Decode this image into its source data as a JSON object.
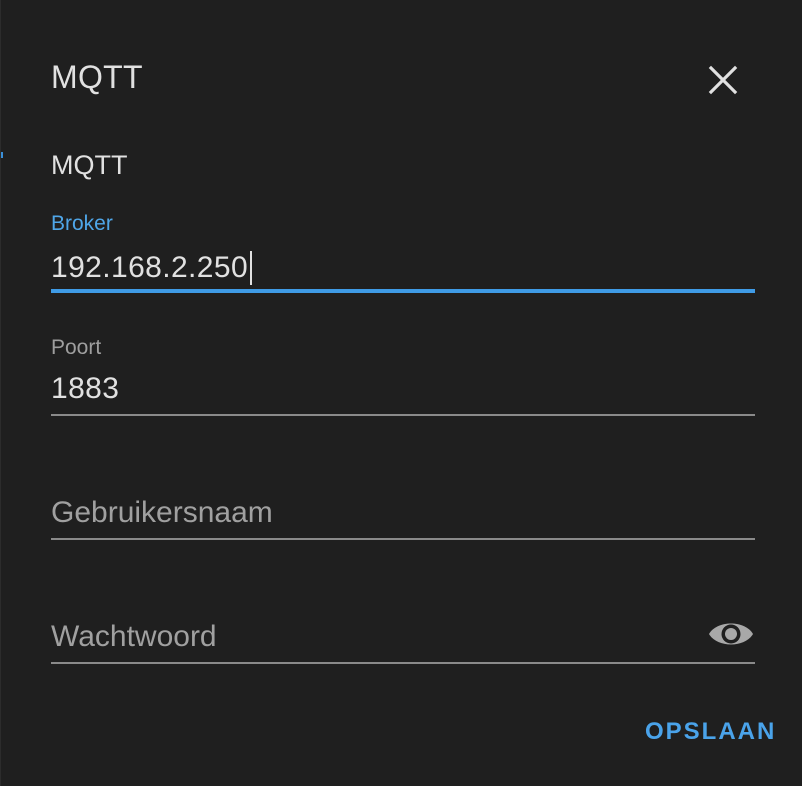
{
  "dialog": {
    "title": "MQTT",
    "close_icon": "close-icon",
    "section_label": "MQTT"
  },
  "fields": {
    "broker": {
      "label": "Broker",
      "value": "192.168.2.250",
      "focused": true
    },
    "port": {
      "label": "Poort",
      "value": "1883"
    },
    "username": {
      "placeholder": "Gebruikersnaam",
      "value": ""
    },
    "password": {
      "placeholder": "Wachtwoord",
      "value": "",
      "toggle_icon": "eye-icon"
    }
  },
  "actions": {
    "save_label": "OPSLAAN"
  },
  "colors": {
    "background": "#1f1f1f",
    "accent": "#3f9be6",
    "text": "#e1e1e1",
    "muted": "#9e9e9e"
  }
}
